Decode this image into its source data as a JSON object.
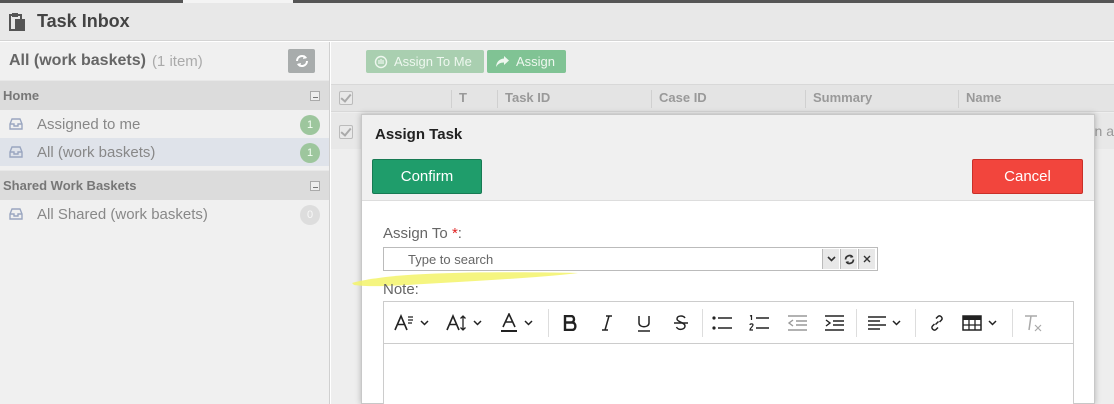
{
  "header": {
    "title": "Task Inbox",
    "icon": "inbox-clipboard-icon"
  },
  "left_panel": {
    "title": "All (work baskets)",
    "count": "(1 item)",
    "sections": [
      {
        "title": "Home",
        "items": [
          {
            "label": "Assigned to me",
            "badge": "1"
          },
          {
            "label": "All (work baskets)",
            "badge": "1",
            "active": true
          }
        ]
      },
      {
        "title": "Shared Work Baskets",
        "items": [
          {
            "label": "All Shared (work baskets)",
            "badge": "0"
          }
        ]
      }
    ]
  },
  "toolbar": {
    "assign_to_me": "Assign To Me",
    "assign": "Assign"
  },
  "grid": {
    "columns": [
      "T",
      "Task ID",
      "Case ID",
      "Summary",
      "Name"
    ],
    "row_tail": "n a"
  },
  "modal": {
    "title": "Assign Task",
    "confirm": "Confirm",
    "cancel": "Cancel",
    "assign_to_label": "Assign To ",
    "required_mark": "*",
    "assign_to_colon": ":",
    "search_placeholder": "Type to search",
    "note_label": "Note:"
  },
  "colors": {
    "confirm": "#1f9d6b",
    "cancel": "#f2453d",
    "highlight": "#f3f36a"
  }
}
